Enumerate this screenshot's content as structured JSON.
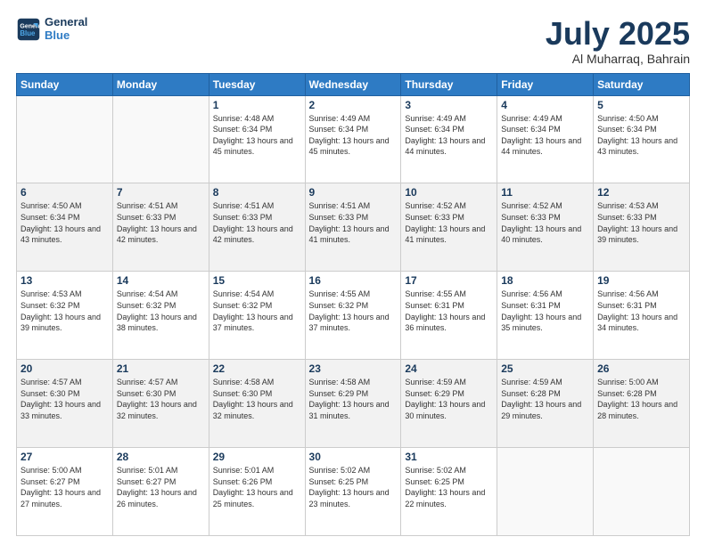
{
  "header": {
    "logo_line1": "General",
    "logo_line2": "Blue",
    "month": "July 2025",
    "location": "Al Muharraq, Bahrain"
  },
  "weekdays": [
    "Sunday",
    "Monday",
    "Tuesday",
    "Wednesday",
    "Thursday",
    "Friday",
    "Saturday"
  ],
  "weeks": [
    [
      {
        "day": "",
        "info": ""
      },
      {
        "day": "",
        "info": ""
      },
      {
        "day": "1",
        "info": "Sunrise: 4:48 AM\nSunset: 6:34 PM\nDaylight: 13 hours and 45 minutes."
      },
      {
        "day": "2",
        "info": "Sunrise: 4:49 AM\nSunset: 6:34 PM\nDaylight: 13 hours and 45 minutes."
      },
      {
        "day": "3",
        "info": "Sunrise: 4:49 AM\nSunset: 6:34 PM\nDaylight: 13 hours and 44 minutes."
      },
      {
        "day": "4",
        "info": "Sunrise: 4:49 AM\nSunset: 6:34 PM\nDaylight: 13 hours and 44 minutes."
      },
      {
        "day": "5",
        "info": "Sunrise: 4:50 AM\nSunset: 6:34 PM\nDaylight: 13 hours and 43 minutes."
      }
    ],
    [
      {
        "day": "6",
        "info": "Sunrise: 4:50 AM\nSunset: 6:34 PM\nDaylight: 13 hours and 43 minutes."
      },
      {
        "day": "7",
        "info": "Sunrise: 4:51 AM\nSunset: 6:33 PM\nDaylight: 13 hours and 42 minutes."
      },
      {
        "day": "8",
        "info": "Sunrise: 4:51 AM\nSunset: 6:33 PM\nDaylight: 13 hours and 42 minutes."
      },
      {
        "day": "9",
        "info": "Sunrise: 4:51 AM\nSunset: 6:33 PM\nDaylight: 13 hours and 41 minutes."
      },
      {
        "day": "10",
        "info": "Sunrise: 4:52 AM\nSunset: 6:33 PM\nDaylight: 13 hours and 41 minutes."
      },
      {
        "day": "11",
        "info": "Sunrise: 4:52 AM\nSunset: 6:33 PM\nDaylight: 13 hours and 40 minutes."
      },
      {
        "day": "12",
        "info": "Sunrise: 4:53 AM\nSunset: 6:33 PM\nDaylight: 13 hours and 39 minutes."
      }
    ],
    [
      {
        "day": "13",
        "info": "Sunrise: 4:53 AM\nSunset: 6:32 PM\nDaylight: 13 hours and 39 minutes."
      },
      {
        "day": "14",
        "info": "Sunrise: 4:54 AM\nSunset: 6:32 PM\nDaylight: 13 hours and 38 minutes."
      },
      {
        "day": "15",
        "info": "Sunrise: 4:54 AM\nSunset: 6:32 PM\nDaylight: 13 hours and 37 minutes."
      },
      {
        "day": "16",
        "info": "Sunrise: 4:55 AM\nSunset: 6:32 PM\nDaylight: 13 hours and 37 minutes."
      },
      {
        "day": "17",
        "info": "Sunrise: 4:55 AM\nSunset: 6:31 PM\nDaylight: 13 hours and 36 minutes."
      },
      {
        "day": "18",
        "info": "Sunrise: 4:56 AM\nSunset: 6:31 PM\nDaylight: 13 hours and 35 minutes."
      },
      {
        "day": "19",
        "info": "Sunrise: 4:56 AM\nSunset: 6:31 PM\nDaylight: 13 hours and 34 minutes."
      }
    ],
    [
      {
        "day": "20",
        "info": "Sunrise: 4:57 AM\nSunset: 6:30 PM\nDaylight: 13 hours and 33 minutes."
      },
      {
        "day": "21",
        "info": "Sunrise: 4:57 AM\nSunset: 6:30 PM\nDaylight: 13 hours and 32 minutes."
      },
      {
        "day": "22",
        "info": "Sunrise: 4:58 AM\nSunset: 6:30 PM\nDaylight: 13 hours and 32 minutes."
      },
      {
        "day": "23",
        "info": "Sunrise: 4:58 AM\nSunset: 6:29 PM\nDaylight: 13 hours and 31 minutes."
      },
      {
        "day": "24",
        "info": "Sunrise: 4:59 AM\nSunset: 6:29 PM\nDaylight: 13 hours and 30 minutes."
      },
      {
        "day": "25",
        "info": "Sunrise: 4:59 AM\nSunset: 6:28 PM\nDaylight: 13 hours and 29 minutes."
      },
      {
        "day": "26",
        "info": "Sunrise: 5:00 AM\nSunset: 6:28 PM\nDaylight: 13 hours and 28 minutes."
      }
    ],
    [
      {
        "day": "27",
        "info": "Sunrise: 5:00 AM\nSunset: 6:27 PM\nDaylight: 13 hours and 27 minutes."
      },
      {
        "day": "28",
        "info": "Sunrise: 5:01 AM\nSunset: 6:27 PM\nDaylight: 13 hours and 26 minutes."
      },
      {
        "day": "29",
        "info": "Sunrise: 5:01 AM\nSunset: 6:26 PM\nDaylight: 13 hours and 25 minutes."
      },
      {
        "day": "30",
        "info": "Sunrise: 5:02 AM\nSunset: 6:25 PM\nDaylight: 13 hours and 23 minutes."
      },
      {
        "day": "31",
        "info": "Sunrise: 5:02 AM\nSunset: 6:25 PM\nDaylight: 13 hours and 22 minutes."
      },
      {
        "day": "",
        "info": ""
      },
      {
        "day": "",
        "info": ""
      }
    ]
  ]
}
